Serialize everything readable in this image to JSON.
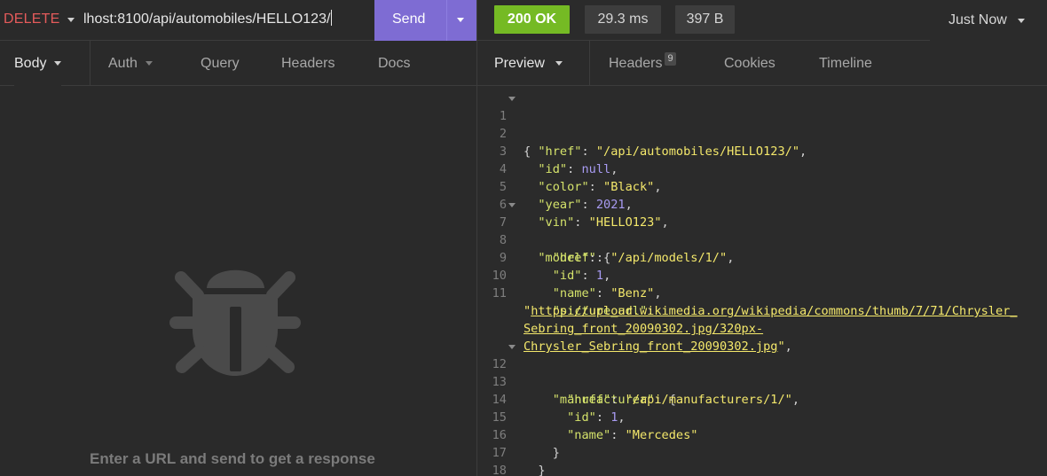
{
  "request": {
    "method": "DELETE",
    "url": "lhost:8100/api/automobiles/HELLO123/",
    "send_label": "Send"
  },
  "left_tabs": [
    {
      "label": "Body"
    },
    {
      "label": "Auth"
    },
    {
      "label": "Query"
    },
    {
      "label": "Headers"
    },
    {
      "label": "Docs"
    }
  ],
  "empty_state": {
    "icon": "bug-icon",
    "text": "Enter a URL and send to get a response"
  },
  "response": {
    "status": "200 OK",
    "time": "29.3 ms",
    "size": "397 B",
    "when": "Just Now",
    "status_color": "#75ba24"
  },
  "right_tabs": [
    {
      "label": "Preview"
    },
    {
      "label": "Headers",
      "count": "9"
    },
    {
      "label": "Cookies"
    },
    {
      "label": "Timeline"
    }
  ],
  "code": {
    "line_numbers": [
      "1",
      "2",
      "3",
      "4",
      "5",
      "6",
      "7",
      "8",
      "9",
      "10",
      "11",
      "12",
      "13",
      "14",
      "15",
      "16",
      "17",
      "18"
    ],
    "keys": {
      "href": "\"href\"",
      "id": "\"id\"",
      "color": "\"color\"",
      "year": "\"year\"",
      "vin": "\"vin\"",
      "model": "\"model\"",
      "model_href": "\"href\"",
      "model_id": "\"id\"",
      "model_name": "\"name\"",
      "picture_url": "\"picture_url\"",
      "manufacturer": "\"manufacturer\"",
      "man_href": "\"href\"",
      "man_id": "\"id\"",
      "man_name": "\"name\""
    },
    "values": {
      "href": "\"/api/automobiles/HELLO123/\"",
      "id": "null",
      "color": "\"Black\"",
      "year": "2021",
      "vin": "\"HELLO123\"",
      "model_href": "\"/api/models/1/\"",
      "model_id": "1",
      "model_name": "\"Benz\"",
      "picture_url_open": "\"",
      "picture_url_1": "https://upload.wikimedia.org/wikipedia/commons/thumb/7/71/Chrysler_",
      "picture_url_2": "Sebring_front_20090302.jpg/320px-",
      "picture_url_3": "Chrysler_Sebring_front_20090302.jpg",
      "picture_url_close": "\"",
      "man_href": "\"/api/manufacturers/1/\"",
      "man_id": "1",
      "man_name": "\"Mercedes\""
    }
  }
}
